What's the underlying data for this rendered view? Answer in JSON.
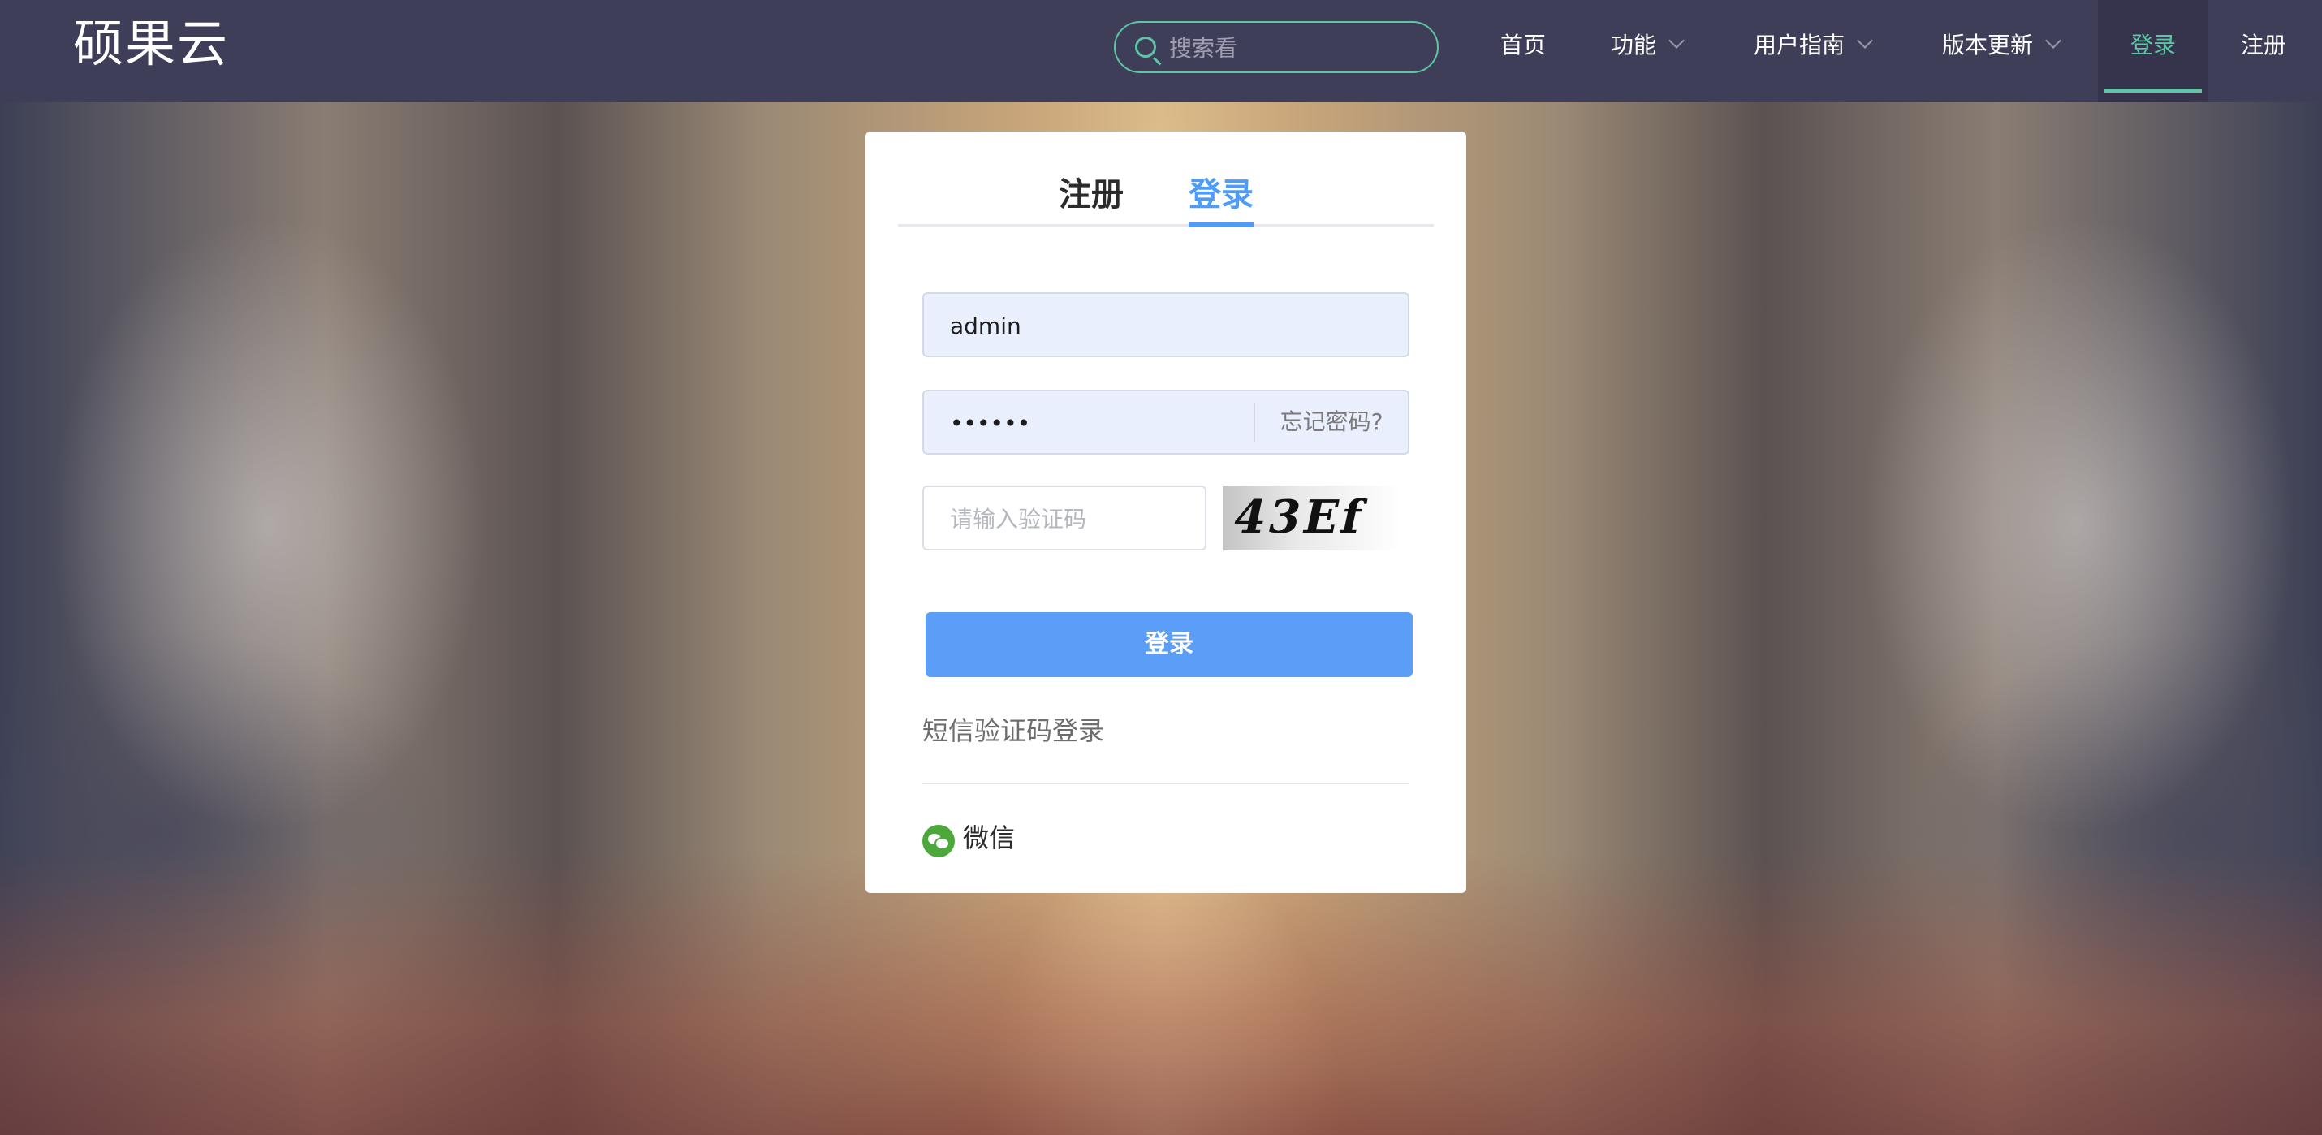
{
  "brand": {
    "logo_text": "硕果云"
  },
  "search": {
    "placeholder": "搜索看"
  },
  "nav": {
    "items": [
      {
        "label": "首页"
      },
      {
        "label": "功能"
      },
      {
        "label": "用户指南"
      },
      {
        "label": "版本更新"
      },
      {
        "label": "登录"
      },
      {
        "label": "注册"
      }
    ],
    "active_color": "#5cc6a6"
  },
  "auth": {
    "tabs": [
      {
        "label": "注册"
      },
      {
        "label": "登录"
      }
    ],
    "active_tab_color": "#4e9cf5",
    "username": {
      "value": "admin"
    },
    "password": {
      "value": "••••••",
      "forgot_label": "忘记密码?"
    },
    "captcha": {
      "placeholder": "请输入验证码",
      "image_text": "43Ef"
    },
    "submit_label": "登录",
    "sms_login_label": "短信验证码登录",
    "wechat_label": "微信",
    "button_color": "#5a9ef7"
  }
}
